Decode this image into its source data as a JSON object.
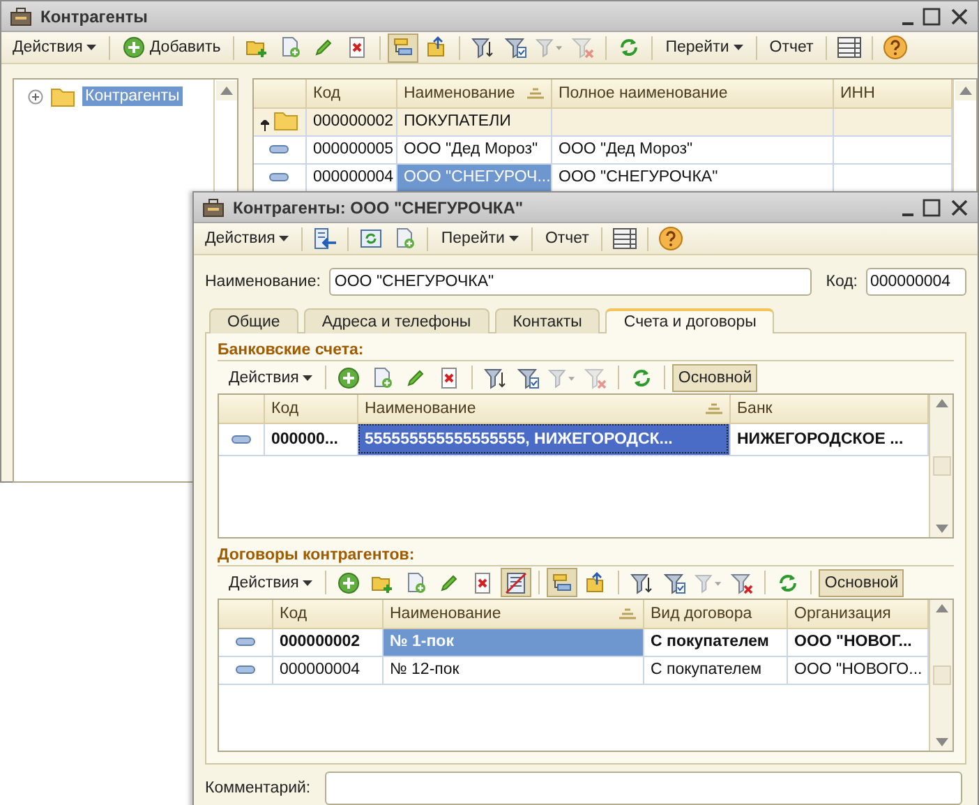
{
  "list_window": {
    "title": "Контрагенты",
    "toolbar": [
      {
        "kind": "menu",
        "label": "Действия"
      },
      {
        "kind": "separator"
      },
      {
        "kind": "button",
        "label": "Добавить",
        "with_icon": true
      },
      {
        "kind": "separator"
      },
      {
        "kind": "tool",
        "pressed": false,
        "disabled": false
      },
      {
        "kind": "tool",
        "pressed": false,
        "disabled": false
      },
      {
        "kind": "tool",
        "pressed": false,
        "disabled": false
      },
      {
        "kind": "tool",
        "pressed": false,
        "disabled": false
      },
      {
        "kind": "separator"
      },
      {
        "kind": "tool",
        "pressed": true,
        "disabled": false
      },
      {
        "kind": "tool",
        "pressed": false,
        "disabled": false
      },
      {
        "kind": "separator"
      },
      {
        "kind": "tool",
        "pressed": false,
        "disabled": false
      },
      {
        "kind": "tool",
        "pressed": false,
        "disabled": false
      },
      {
        "kind": "tool",
        "pressed": false,
        "disabled": true
      },
      {
        "kind": "tool",
        "pressed": false,
        "disabled": true
      },
      {
        "kind": "separator"
      },
      {
        "kind": "tool",
        "pressed": false,
        "disabled": false
      },
      {
        "kind": "separator"
      },
      {
        "kind": "menu",
        "label": "Перейти"
      },
      {
        "kind": "separator"
      },
      {
        "kind": "button",
        "label": "Отчет",
        "with_icon": false
      },
      {
        "kind": "separator"
      },
      {
        "kind": "tool",
        "pressed": false,
        "disabled": false
      },
      {
        "kind": "separator"
      },
      {
        "kind": "tool",
        "pressed": false,
        "disabled": false
      }
    ],
    "tree": [
      {
        "label": "Контрагенты",
        "selected": true,
        "expanded": false
      }
    ],
    "grid": {
      "columns": [
        {
          "label": "Код",
          "sorted": false
        },
        {
          "label": "Наименование",
          "sorted": true
        },
        {
          "label": "Полное наименование",
          "sorted": false
        },
        {
          "label": "ИНН",
          "sorted": false
        }
      ],
      "rows": [
        {
          "kind": "group",
          "selected": false,
          "bold": false,
          "cells": [
            "000000002",
            "ПОКУПАТЕЛИ"
          ]
        },
        {
          "kind": "item",
          "selected": false,
          "bold": false,
          "cells": [
            "000000005",
            "ООО \"Дед Мороз\"",
            "ООО \"Дед Мороз\""
          ]
        },
        {
          "kind": "item",
          "selected": true,
          "bold": false,
          "cells": [
            "000000004",
            "ООО \"СНЕГУРОЧ...",
            "ООО \"СНЕГУРОЧКА\""
          ]
        }
      ]
    }
  },
  "item_window": {
    "title": "Контрагенты: ООО \"СНЕГУРОЧКА\"",
    "toolbar": [
      {
        "kind": "menu",
        "label": "Действия"
      },
      {
        "kind": "separator"
      },
      {
        "kind": "tool",
        "pressed": false,
        "disabled": false
      },
      {
        "kind": "separator"
      },
      {
        "kind": "tool",
        "pressed": false,
        "disabled": false
      },
      {
        "kind": "tool",
        "pressed": false,
        "disabled": false
      },
      {
        "kind": "separator"
      },
      {
        "kind": "menu",
        "label": "Перейти"
      },
      {
        "kind": "separator"
      },
      {
        "kind": "button",
        "label": "Отчет",
        "with_icon": false
      },
      {
        "kind": "separator"
      },
      {
        "kind": "tool",
        "pressed": false,
        "disabled": false
      },
      {
        "kind": "separator"
      },
      {
        "kind": "tool",
        "pressed": false,
        "disabled": false
      }
    ],
    "name_field": {
      "label": "Наименование:",
      "value": "ООО \"СНЕГУРОЧКА\""
    },
    "code_field": {
      "label": "Код:",
      "value": "000000004"
    },
    "tabs": [
      {
        "label": "Общие",
        "selected": false
      },
      {
        "label": "Адреса и телефоны",
        "selected": false
      },
      {
        "label": "Контакты",
        "selected": false
      },
      {
        "label": "Счета и договоры",
        "selected": true
      }
    ],
    "bank_accounts": {
      "title": "Банковские счета:",
      "toolbar": [
        {
          "kind": "menu",
          "label": "Действия"
        },
        {
          "kind": "separator"
        },
        {
          "kind": "tool",
          "pressed": false,
          "disabled": false
        },
        {
          "kind": "tool",
          "pressed": false,
          "disabled": false
        },
        {
          "kind": "tool",
          "pressed": false,
          "disabled": false
        },
        {
          "kind": "tool",
          "pressed": false,
          "disabled": false
        },
        {
          "kind": "separator"
        },
        {
          "kind": "tool",
          "pressed": false,
          "disabled": false
        },
        {
          "kind": "tool",
          "pressed": false,
          "disabled": false
        },
        {
          "kind": "tool",
          "pressed": false,
          "disabled": true
        },
        {
          "kind": "tool",
          "pressed": false,
          "disabled": true
        },
        {
          "kind": "separator"
        },
        {
          "kind": "tool",
          "pressed": false,
          "disabled": false
        },
        {
          "kind": "separator"
        },
        {
          "kind": "toggle",
          "label": "Основной",
          "pressed": true
        }
      ],
      "grid": {
        "columns": [
          {
            "label": "Код",
            "sorted": false
          },
          {
            "label": "Наименование",
            "sorted": true
          },
          {
            "label": "Банк",
            "sorted": false
          }
        ],
        "rows": [
          {
            "kind": "item",
            "selected": true,
            "bold": true,
            "cells": [
              "000000...",
              "555555555555555555, НИЖЕГОРОДСК...",
              "НИЖЕГОРОДСКОЕ ..."
            ]
          }
        ]
      }
    },
    "contracts": {
      "title": "Договоры контрагентов:",
      "toolbar": [
        {
          "kind": "menu",
          "label": "Действия"
        },
        {
          "kind": "separator"
        },
        {
          "kind": "tool",
          "pressed": false,
          "disabled": false
        },
        {
          "kind": "tool",
          "pressed": false,
          "disabled": false
        },
        {
          "kind": "tool",
          "pressed": false,
          "disabled": false
        },
        {
          "kind": "tool",
          "pressed": false,
          "disabled": false
        },
        {
          "kind": "tool",
          "pressed": false,
          "disabled": false
        },
        {
          "kind": "tool",
          "pressed": true,
          "disabled": false
        },
        {
          "kind": "separator"
        },
        {
          "kind": "tool",
          "pressed": true,
          "disabled": false
        },
        {
          "kind": "tool",
          "pressed": false,
          "disabled": false
        },
        {
          "kind": "separator"
        },
        {
          "kind": "tool",
          "pressed": false,
          "disabled": false
        },
        {
          "kind": "tool",
          "pressed": false,
          "disabled": false
        },
        {
          "kind": "tool",
          "pressed": false,
          "disabled": true
        },
        {
          "kind": "tool",
          "pressed": false,
          "disabled": false
        },
        {
          "kind": "separator"
        },
        {
          "kind": "tool",
          "pressed": false,
          "disabled": false
        },
        {
          "kind": "separator"
        },
        {
          "kind": "toggle",
          "label": "Основной",
          "pressed": true
        }
      ],
      "grid": {
        "columns": [
          {
            "label": "Код",
            "sorted": false
          },
          {
            "label": "Наименование",
            "sorted": true
          },
          {
            "label": "Вид договора",
            "sorted": false
          },
          {
            "label": "Организация",
            "sorted": false
          }
        ],
        "rows": [
          {
            "kind": "item",
            "selected": true,
            "bold": true,
            "cells": [
              "000000002",
              "№ 1-пок",
              "С покупателем",
              "ООО \"НОВОГ..."
            ]
          },
          {
            "kind": "item",
            "selected": false,
            "bold": false,
            "cells": [
              "000000004",
              "№ 12-пок",
              "С покупателем",
              "ООО \"НОВОГО..."
            ]
          }
        ]
      }
    },
    "comment": {
      "label": "Комментарий:"
    }
  }
}
